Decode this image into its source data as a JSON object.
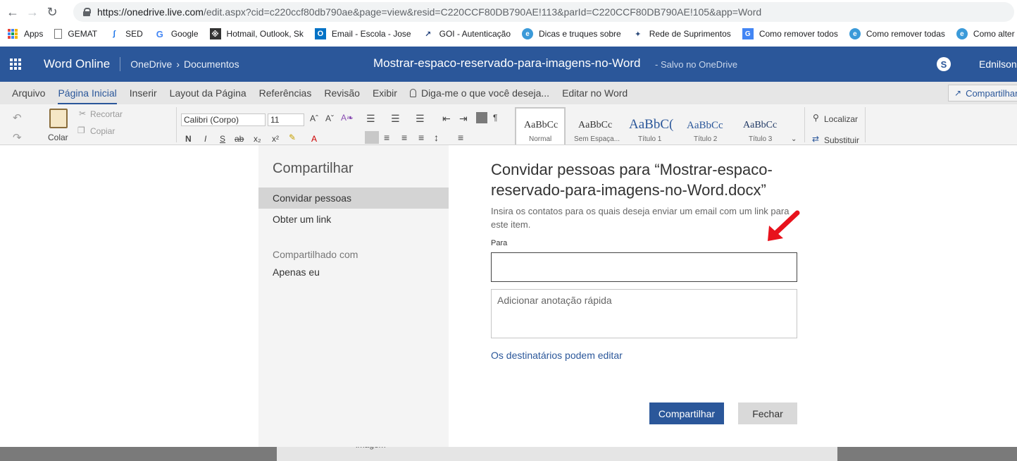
{
  "browser": {
    "url_host": "https://onedrive.live.com",
    "url_rest": "/edit.aspx?cid=c220ccf80db790ae&page=view&resid=C220CCF80DB790AE!113&parId=C220CCF80DB790AE!105&app=Word"
  },
  "bookmarks": [
    {
      "icon": "apps-grid-icon",
      "label": "Apps"
    },
    {
      "icon": "page-icon",
      "label": "GEMAT"
    },
    {
      "icon": "sed-icon",
      "label": "SED"
    },
    {
      "icon": "google-icon",
      "label": "Google"
    },
    {
      "icon": "hotmail-icon",
      "label": "Hotmail, Outlook, Sk"
    },
    {
      "icon": "outlook-icon",
      "label": "Email - Escola - Jose"
    },
    {
      "icon": "goi-icon",
      "label": "GOI - Autenticação"
    },
    {
      "icon": "globe-icon",
      "label": "Dicas e truques sobre"
    },
    {
      "icon": "network-icon",
      "label": "Rede de Suprimentos"
    },
    {
      "icon": "translate-icon",
      "label": "Como remover todos"
    },
    {
      "icon": "globe-icon",
      "label": "Como remover todas"
    },
    {
      "icon": "globe-icon",
      "label": "Como alter"
    }
  ],
  "header": {
    "app_name": "Word Online",
    "breadcrumb_root": "OneDrive",
    "breadcrumb_sep": "›",
    "breadcrumb_folder": "Documentos",
    "doc_title": "Mostrar-espaco-reservado-para-imagens-no-Word",
    "save_status": "-   Salvo no OneDrive",
    "user_name": "Ednilson"
  },
  "ribbon": {
    "tabs": [
      "Arquivo",
      "Página Inicial",
      "Inserir",
      "Layout da Página",
      "Referências",
      "Revisão",
      "Exibir"
    ],
    "tell_me": "Diga-me o que você deseja...",
    "edit_in_word": "Editar no Word",
    "share_label": "Compartilhar",
    "paste_label": "Colar",
    "cut_label": "Recortar",
    "copy_label": "Copiar",
    "font_name": "Calibri (Corpo)",
    "font_size": "11",
    "styles": [
      {
        "sample": "AaBbCc",
        "label": "Normal"
      },
      {
        "sample": "AaBbCc",
        "label": "Sem Espaça..."
      },
      {
        "sample": "AaBbC(",
        "label": "Título 1"
      },
      {
        "sample": "AaBbCc",
        "label": "Título 2"
      },
      {
        "sample": "AaBbCc",
        "label": "Título 3"
      }
    ],
    "find_label": "Localizar",
    "replace_label": "Substituir"
  },
  "dialog": {
    "title": "Compartilhar",
    "nav": [
      {
        "label": "Convidar pessoas",
        "selected": true
      },
      {
        "label": "Obter um link",
        "selected": false
      }
    ],
    "shared_with_heading": "Compartilhado com",
    "shared_with_value": "Apenas eu",
    "invite_title": "Convidar pessoas para “Mostrar-espaco-reservado-para-imagens-no-Word.docx”",
    "invite_desc": "Insira os contatos para os quais deseja enviar um email com um link para este item.",
    "to_label": "Para",
    "to_value": "",
    "note_placeholder": "Adicionar anotação rápida",
    "permissions_link": "Os destinatários podem editar",
    "share_button": "Compartilhar",
    "close_button": "Fechar"
  },
  "document": {
    "snippet": "imagem"
  },
  "colors": {
    "word_blue": "#2b579a",
    "annotation_arrow": "#e8121c"
  }
}
